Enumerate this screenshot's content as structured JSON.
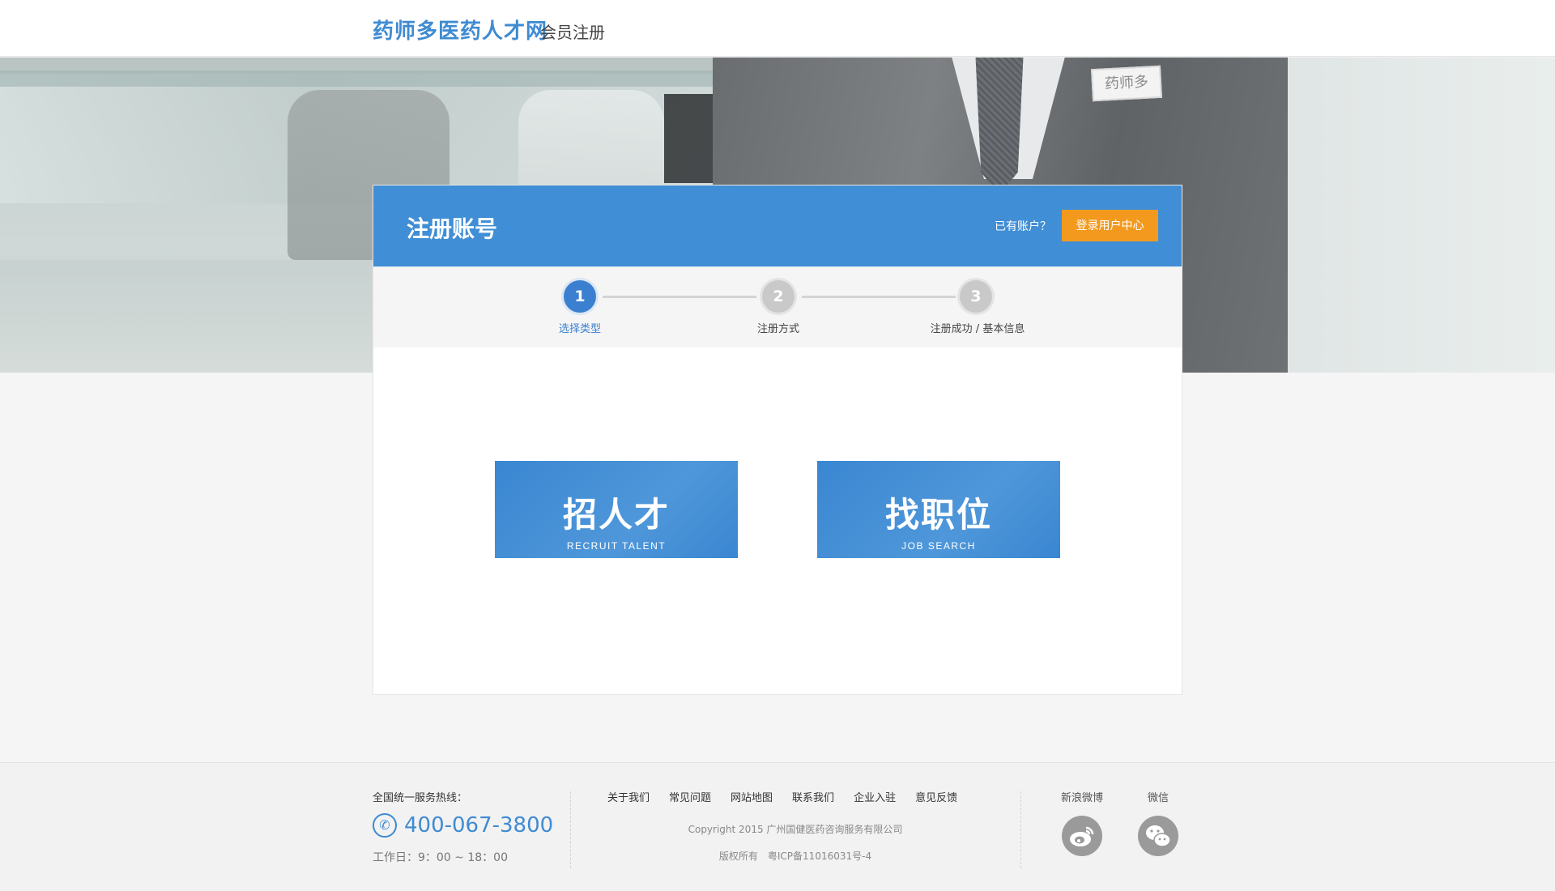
{
  "header": {
    "brand": "药师多医药人才网",
    "subtitle": "会员注册"
  },
  "hero": {
    "badge_text": "药师多"
  },
  "card": {
    "title": "注册账号",
    "have_account": "已有账户？",
    "login_button": "登录用户中心",
    "steps": [
      {
        "number": "1",
        "label": "选择类型",
        "active": true
      },
      {
        "number": "2",
        "label": "注册方式",
        "active": false
      },
      {
        "number": "3",
        "label": "注册成功 / 基本信息",
        "active": false
      }
    ],
    "choices": [
      {
        "main": "招人才",
        "sub": "RECRUIT TALENT"
      },
      {
        "main": "找职位",
        "sub": "JOB SEARCH"
      }
    ]
  },
  "footer": {
    "hotline_label": "全国统一服务热线：",
    "hotline_number": "400-067-3800",
    "work_hours": "工作日：9：00 ~ 18：00",
    "links": [
      "关于我们",
      "常见问题",
      "网站地图",
      "联系我们",
      "企业入驻",
      "意见反馈"
    ],
    "copyright": "Copyright 2015 广州国健医药咨询服务有限公司",
    "icp": "版权所有　粤ICP备11016031号-4",
    "social": [
      {
        "label": "新浪微博",
        "icon": "weibo-icon"
      },
      {
        "label": "微信",
        "icon": "wechat-icon"
      }
    ]
  },
  "colors": {
    "brand_blue": "#408ed5",
    "login_orange": "#f39a1e",
    "step_active": "#3b7fd0",
    "step_idle": "#c9c9c9"
  }
}
